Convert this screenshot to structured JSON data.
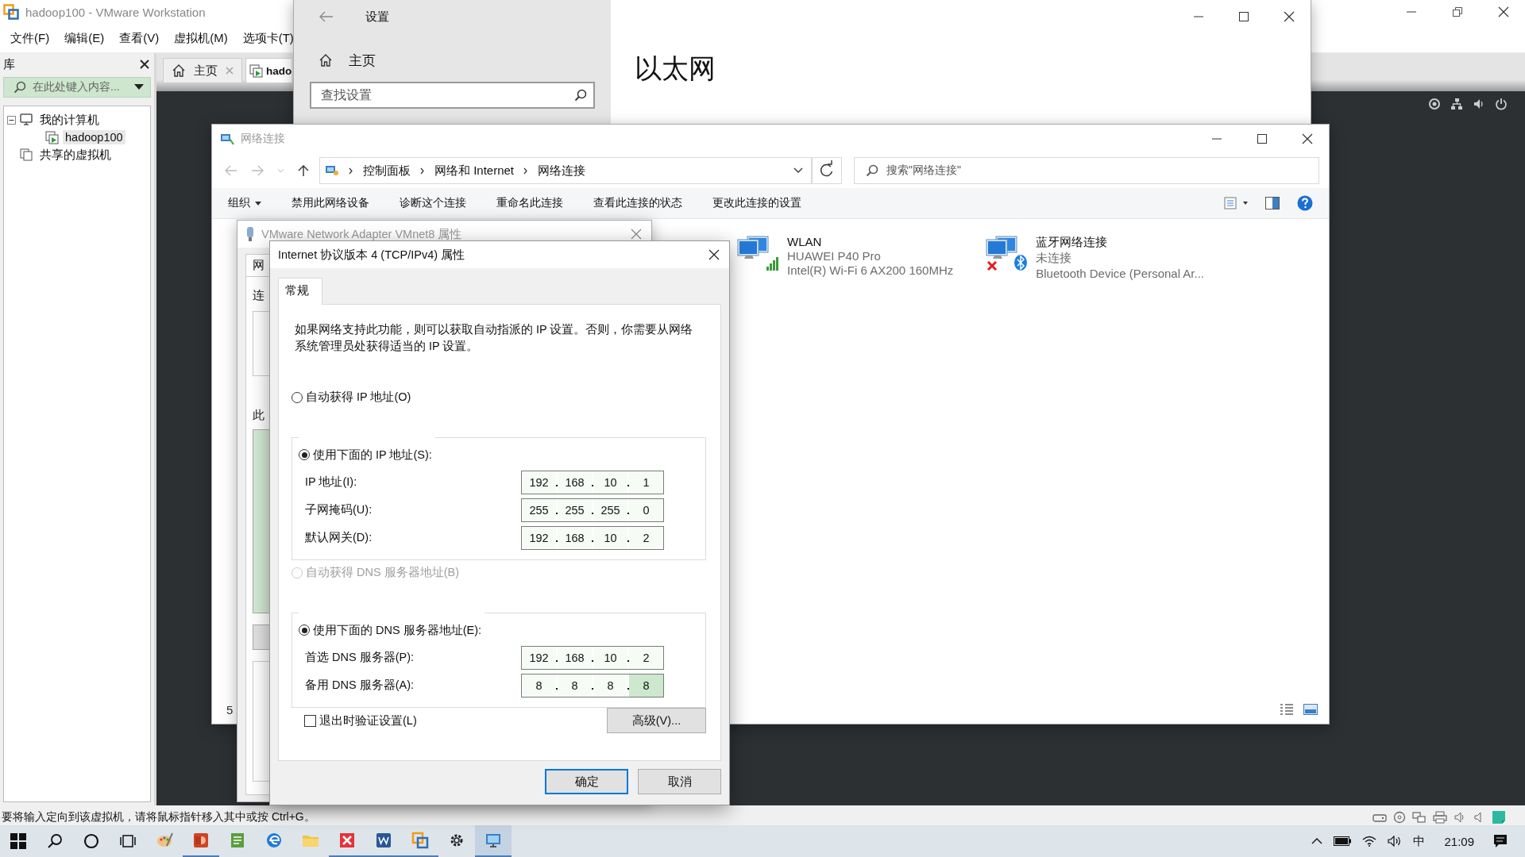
{
  "vmware": {
    "title": "hadoop100 - VMware Workstation",
    "menu": [
      "文件(F)",
      "编辑(E)",
      "查看(V)",
      "虚拟机(M)",
      "选项卡(T)"
    ],
    "library": {
      "title": "库",
      "search_placeholder": "在此处键入内容...",
      "tree": [
        {
          "label": "我的计算机",
          "kind": "computer",
          "expanded": true,
          "selected": false,
          "children": [
            {
              "label": "hadoop100",
              "kind": "vm",
              "selected": true
            }
          ]
        },
        {
          "label": "共享的虚拟机",
          "kind": "shared",
          "selected": false
        }
      ]
    },
    "tabs": [
      {
        "label": "主页",
        "kind": "home",
        "closable": true,
        "selected": false
      },
      {
        "label": "hado",
        "kind": "vm",
        "closable": false,
        "selected": true
      }
    ],
    "status_text": "要将输入定向到该虚拟机，请将鼠标指针移入其中或按 Ctrl+G。"
  },
  "settings": {
    "title": "设置",
    "nav": [
      {
        "label": "主页"
      }
    ],
    "search_placeholder": "查找设置",
    "heading": "以太网"
  },
  "network_connections": {
    "title": "网络连接",
    "breadcrumb": [
      "控制面板",
      "网络和 Internet",
      "网络连接"
    ],
    "search_placeholder": "搜索\"网络连接\"",
    "toolbar": [
      {
        "label": "组织",
        "kind": "menu"
      },
      {
        "label": "禁用此网络设备",
        "kind": "command"
      },
      {
        "label": "诊断这个连接",
        "kind": "command"
      },
      {
        "label": "重命名此连接",
        "kind": "command"
      },
      {
        "label": "查看此连接的状态",
        "kind": "command"
      },
      {
        "label": "更改此连接的设置",
        "kind": "command"
      }
    ],
    "connections": [
      {
        "kind": "wifi",
        "name": "WLAN",
        "status": "HUAWEI P40 Pro",
        "device": "Intel(R) Wi-Fi 6 AX200 160MHz",
        "connected": true
      },
      {
        "kind": "bluetooth",
        "name": "蓝牙网络连接",
        "status": "未连接",
        "device": "Bluetooth Device (Personal Ar...",
        "connected": false
      }
    ],
    "item_count": "5"
  },
  "adapter_dialog": {
    "title": "VMware Network Adapter VMnet8 属性",
    "tab": "网",
    "label_1": "连",
    "label_2": "此"
  },
  "ipv4_dialog": {
    "title": "Internet 协议版本 4 (TCP/IPv4) 属性",
    "tabs": [
      {
        "label": "常规",
        "selected": true
      }
    ],
    "description": "如果网络支持此功能，则可以获取自动指派的 IP 设置。否则，你需要从网络系统管理员处获得适当的 IP 设置。",
    "ip_mode": [
      {
        "label": "自动获得 IP 地址(O)",
        "selected": false,
        "disabled": false
      },
      {
        "label": "使用下面的 IP 地址(S):",
        "selected": true,
        "disabled": false
      }
    ],
    "ip_fields": [
      {
        "label": "IP 地址(I):",
        "octets": [
          {
            "value": "192",
            "selected": false
          },
          {
            "value": "168",
            "selected": false
          },
          {
            "value": "10",
            "selected": false
          },
          {
            "value": "1",
            "selected": false
          }
        ]
      },
      {
        "label": "子网掩码(U):",
        "octets": [
          {
            "value": "255",
            "selected": false
          },
          {
            "value": "255",
            "selected": false
          },
          {
            "value": "255",
            "selected": false
          },
          {
            "value": "0",
            "selected": false
          }
        ]
      },
      {
        "label": "默认网关(D):",
        "octets": [
          {
            "value": "192",
            "selected": false
          },
          {
            "value": "168",
            "selected": false
          },
          {
            "value": "10",
            "selected": false
          },
          {
            "value": "2",
            "selected": false
          }
        ]
      }
    ],
    "dns_mode": [
      {
        "label": "自动获得 DNS 服务器地址(B)",
        "selected": false,
        "disabled": true
      },
      {
        "label": "使用下面的 DNS 服务器地址(E):",
        "selected": true,
        "disabled": false
      }
    ],
    "dns_fields": [
      {
        "label": "首选 DNS 服务器(P):",
        "octets": [
          {
            "value": "192",
            "selected": false
          },
          {
            "value": "168",
            "selected": false
          },
          {
            "value": "10",
            "selected": false
          },
          {
            "value": "2",
            "selected": false
          }
        ]
      },
      {
        "label": "备用 DNS 服务器(A):",
        "octets": [
          {
            "value": "8",
            "selected": false
          },
          {
            "value": "8",
            "selected": false
          },
          {
            "value": "8",
            "selected": false
          },
          {
            "value": "8",
            "selected": true
          }
        ]
      }
    ],
    "validate_on_exit": {
      "label": "退出时验证设置(L)",
      "checked": false
    },
    "advanced_button": "高级(V)...",
    "buttons": [
      {
        "label": "确定",
        "default": true
      },
      {
        "label": "取消",
        "default": false
      }
    ]
  },
  "taskbar": {
    "apps": [
      {
        "kind": "paint",
        "running": false,
        "selected": false
      },
      {
        "kind": "powerpoint",
        "running": true,
        "selected": false
      },
      {
        "kind": "notes",
        "running": false,
        "selected": false
      },
      {
        "kind": "edge",
        "running": false,
        "selected": false
      },
      {
        "kind": "folder",
        "running": false,
        "selected": false
      },
      {
        "kind": "xmind",
        "running": true,
        "selected": false
      },
      {
        "kind": "word",
        "running": true,
        "selected": false
      },
      {
        "kind": "vmware",
        "running": true,
        "selected": false
      },
      {
        "kind": "settings",
        "running": false,
        "selected": false
      },
      {
        "kind": "network",
        "running": true,
        "selected": true
      }
    ],
    "ime": "中",
    "time": "21:09"
  }
}
